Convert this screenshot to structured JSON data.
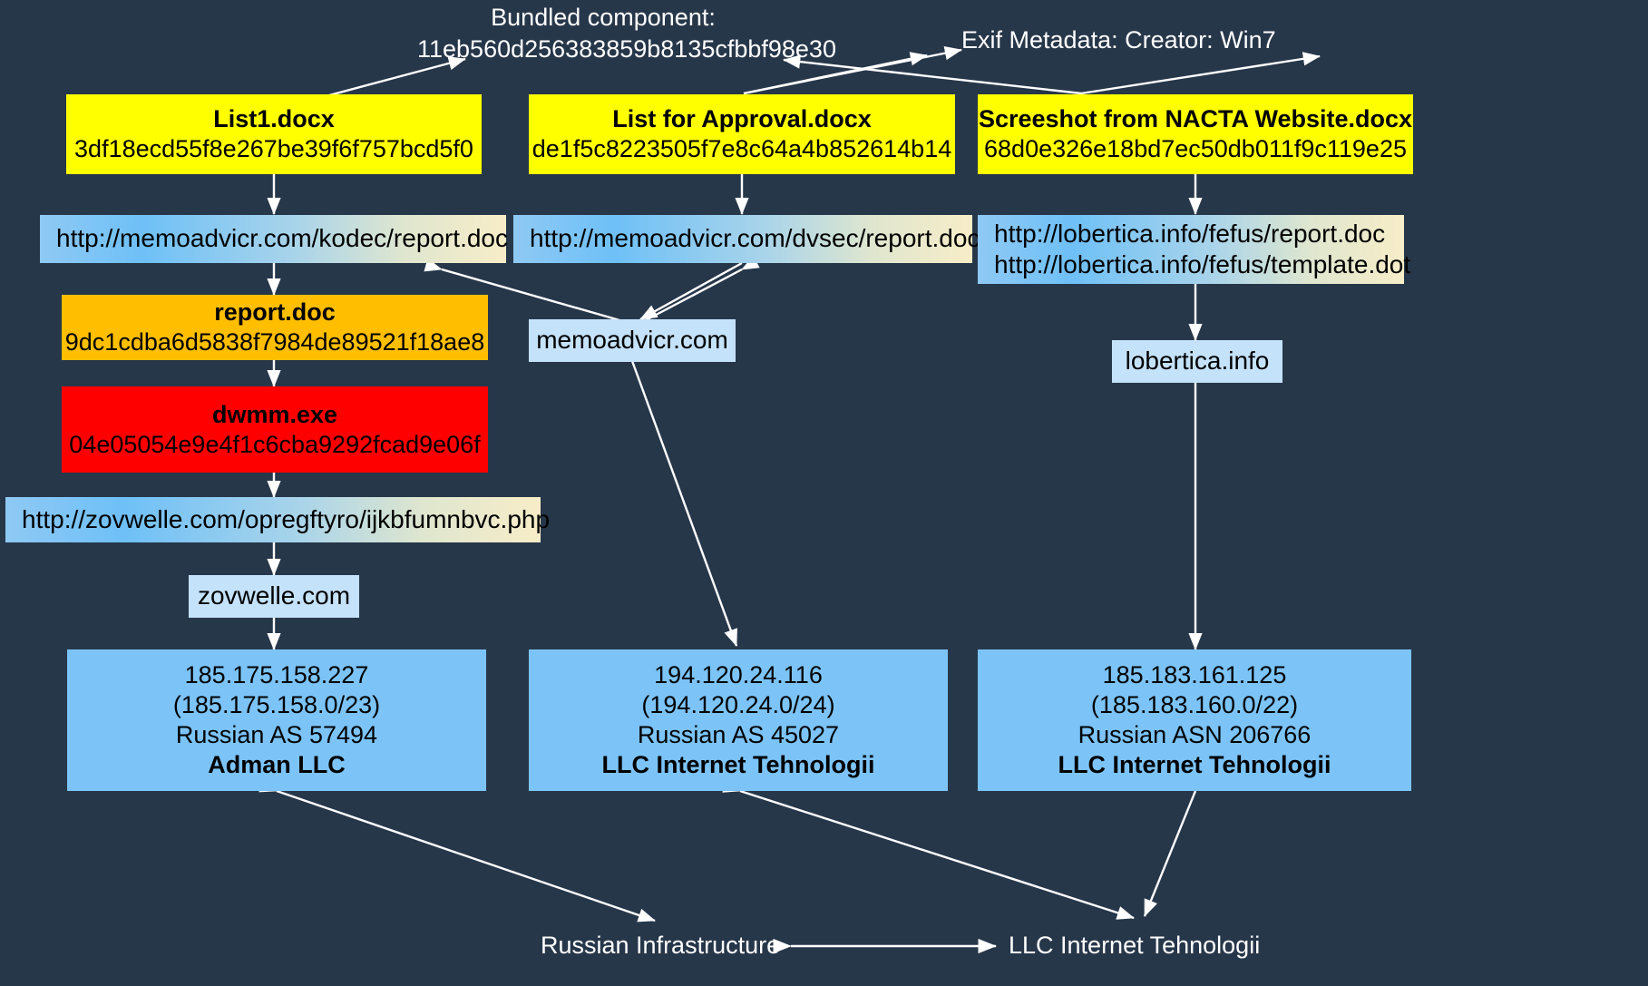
{
  "diagram": {
    "background_color": "#27374a",
    "annotations": [
      {
        "id": "bundled",
        "line1": "Bundled component:",
        "line2": "11eb560d256383859b8135cfbbf98e30"
      },
      {
        "id": "exif",
        "line1": "Exif Metadata: Creator: Win7",
        "line2": ""
      },
      {
        "id": "russian-infrastructure",
        "line1": "Russian Infrastructure",
        "line2": ""
      },
      {
        "id": "llc-internet-tehnologii",
        "line1": "LLC Internet Tehnologii",
        "line2": ""
      }
    ],
    "documents": [
      {
        "id": "list1",
        "name": "List1.docx",
        "hash": "3df18ecd55f8e267be39f6f757bcd5f0",
        "color": "#ffff00"
      },
      {
        "id": "list-approval",
        "name": "List for Approval.docx",
        "hash": "de1f5c8223505f7e8c64a4b852614b14",
        "color": "#ffff00"
      },
      {
        "id": "screeshot-nacta",
        "name": "Screeshot from NACTA Website.docx",
        "hash": "68d0e326e18bd7ec50db011f9c119e25",
        "color": "#ffff00"
      }
    ],
    "urls": [
      {
        "id": "url-kodec",
        "lines": [
          "http://memoadvicr.com/kodec/report.doc"
        ]
      },
      {
        "id": "url-dvsec",
        "lines": [
          "http://memoadvicr.com/dvsec/report.doc"
        ]
      },
      {
        "id": "url-lobertica",
        "lines": [
          "http://lobertica.info/fefus/report.doc",
          "http://lobertica.info/fefus/template.dot"
        ]
      },
      {
        "id": "url-zovwelle",
        "lines": [
          "http://zovwelle.com/opregftyro/ijkbfumnbvc.php"
        ]
      }
    ],
    "payloads": [
      {
        "id": "report-doc",
        "name": "report.doc",
        "hash": "9dc1cdba6d5838f7984de89521f18ae8",
        "color": "#ffbf00"
      },
      {
        "id": "dwmm-exe",
        "name": "dwmm.exe",
        "hash": "04e05054e9e4f1c6cba9292fcad9e06f",
        "color": "#ff0000"
      }
    ],
    "domains": [
      {
        "id": "memoadvicr",
        "name": "memoadvicr.com"
      },
      {
        "id": "lobertica",
        "name": "lobertica.info"
      },
      {
        "id": "zovwelle",
        "name": "zovwelle.com"
      }
    ],
    "hosts": [
      {
        "id": "host-adman",
        "ip": "185.175.158.227",
        "cidr": "(185.175.158.0/23)",
        "asn": "Russian AS 57494",
        "org": "Adman LLC"
      },
      {
        "id": "host-45027",
        "ip": "194.120.24.116",
        "cidr": "(194.120.24.0/24)",
        "asn": "Russian AS 45027",
        "org": "LLC Internet Tehnologii"
      },
      {
        "id": "host-206766",
        "ip": "185.183.161.125",
        "cidr": "(185.183.160.0/22)",
        "asn": "Russian ASN 206766",
        "org": "LLC Internet Tehnologii"
      }
    ]
  }
}
